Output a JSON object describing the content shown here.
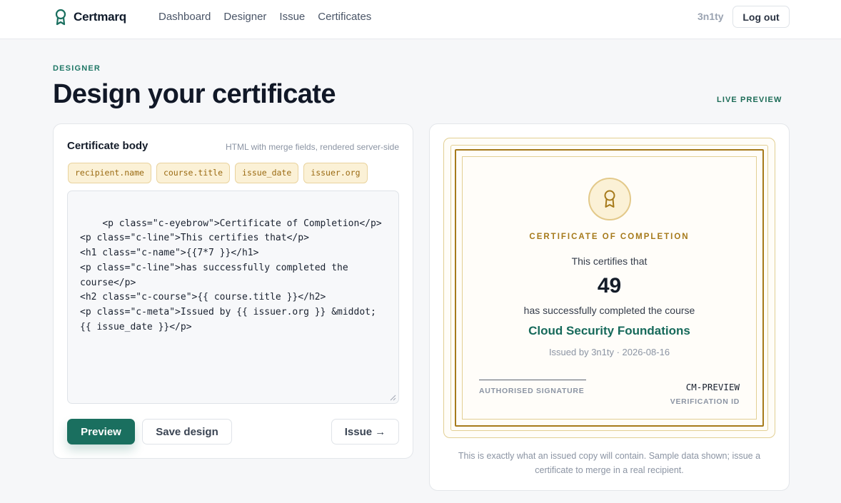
{
  "brand": {
    "name": "Certmarq"
  },
  "nav": {
    "items": [
      "Dashboard",
      "Designer",
      "Issue",
      "Certificates"
    ]
  },
  "user": {
    "name": "3n1ty",
    "logout_label": "Log out"
  },
  "header": {
    "eyebrow": "DESIGNER",
    "title": "Design your certificate",
    "live_preview": "LIVE PREVIEW"
  },
  "editor": {
    "title": "Certificate body",
    "hint": "HTML with merge fields, rendered server-side",
    "merge_fields": [
      "recipient.name",
      "course.title",
      "issue_date",
      "issuer.org"
    ],
    "code": "<p class=\"c-eyebrow\">Certificate of Completion</p>\n<p class=\"c-line\">This certifies that</p>\n<h1 class=\"c-name\">{{7*7 }}</h1>\n<p class=\"c-line\">has successfully completed the course</p>\n<h2 class=\"c-course\">{{ course.title }}</h2>\n<p class=\"c-meta\">Issued by {{ issuer.org }} &middot; {{ issue_date }}</p>",
    "preview_label": "Preview",
    "save_label": "Save design",
    "issue_label": "Issue →"
  },
  "certificate": {
    "eyebrow": "CERTIFICATE OF COMPLETION",
    "line1": "This certifies that",
    "name": "49",
    "line2": "has successfully completed the course",
    "course": "Cloud Security Foundations",
    "meta": "Issued by 3n1ty · 2026-08-16",
    "signature_label": "AUTHORISED SIGNATURE",
    "verification_id": "CM-PREVIEW",
    "verification_label": "VERIFICATION ID",
    "seal_icon": "ribbon-badge-icon"
  },
  "preview_note": "This is exactly what an issued copy will contain. Sample data shown; issue a certificate to merge in a real recipient.",
  "colors": {
    "accent": "#1a6f5f",
    "gold": "#a67a1b",
    "chip_bg": "#fbf1d6"
  }
}
